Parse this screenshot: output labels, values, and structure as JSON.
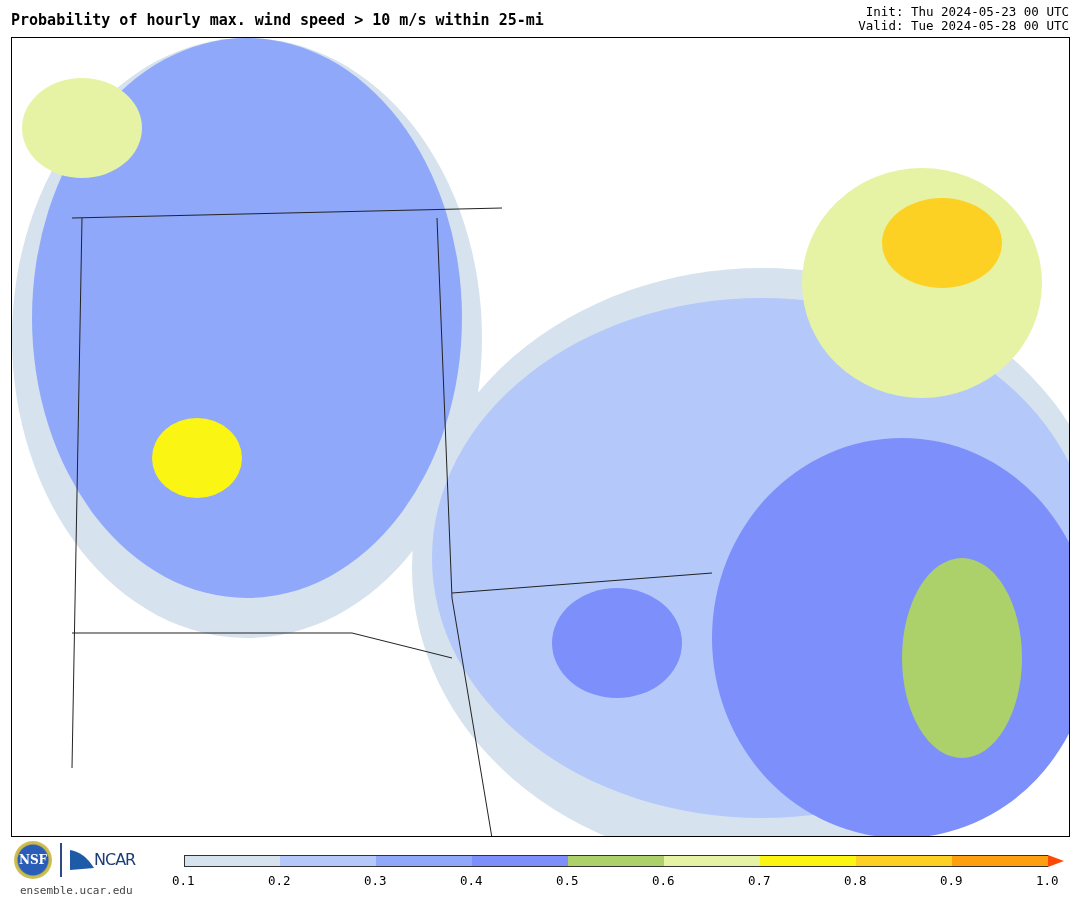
{
  "title": "Probability of hourly max. wind speed > 10 m/s within 25-mi",
  "init": "Init: Thu 2024-05-23 00 UTC",
  "valid": "Valid: Tue 2024-05-28 00 UTC",
  "logos": {
    "nsf": "NSF",
    "ncar": "NCAR",
    "site": "ensemble.ucar.edu"
  },
  "colorbar": {
    "segments": [
      {
        "color": "#d6e2ee"
      },
      {
        "color": "#b4c8fa"
      },
      {
        "color": "#8fa8fa"
      },
      {
        "color": "#7d8ffa"
      },
      {
        "color": "#acd06a"
      },
      {
        "color": "#e6f3a5"
      },
      {
        "color": "#fbf514"
      },
      {
        "color": "#fdd123"
      },
      {
        "color": "#fd9f0f"
      }
    ],
    "extend": {
      "color": "#fc4a06"
    },
    "ticks": [
      "0.1",
      "0.2",
      "0.3",
      "0.4",
      "0.5",
      "0.6",
      "0.7",
      "0.8",
      "0.9",
      "1.0"
    ]
  }
}
